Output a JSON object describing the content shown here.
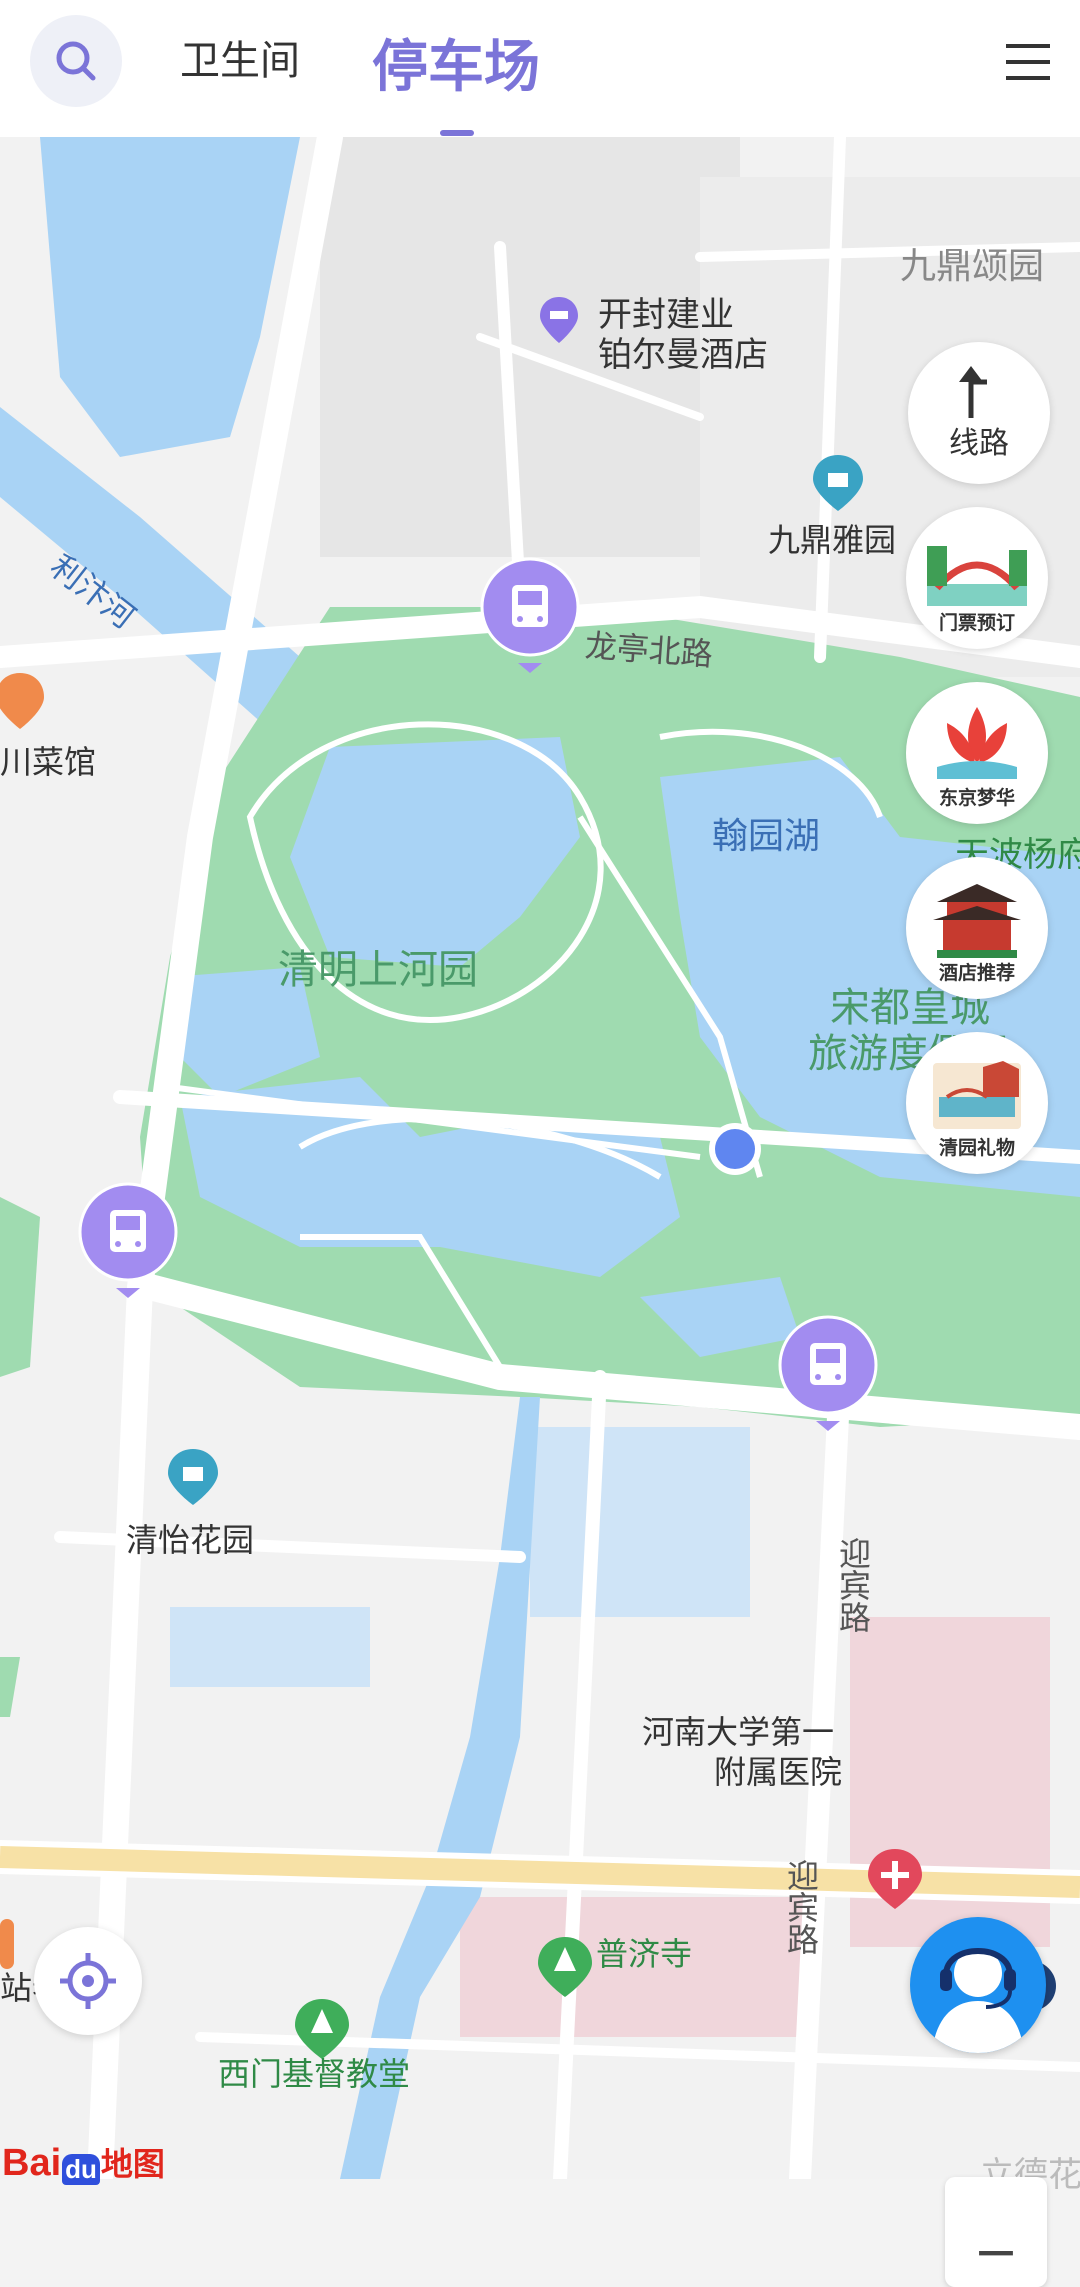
{
  "header": {
    "search_icon": "search-icon",
    "tabs": [
      {
        "label": "卫生间",
        "active": false
      },
      {
        "label": "停车场",
        "active": true
      }
    ],
    "menu_icon": "hamburger-menu-icon",
    "accent_color": "#7b74d8"
  },
  "map": {
    "labels": {
      "jiuding_song": "九鼎颂园",
      "hotel_line1": "开封建业",
      "hotel_line2": "铂尔曼酒店",
      "jiuding_ya": "九鼎雅园",
      "river": "利汴河",
      "longting_road": "龙亭北路",
      "sichuan": "川菜馆",
      "hanyuan_lake": "翰园湖",
      "tianbo": "天波杨府",
      "qingming": "清明上河园",
      "songdu_line1": "宋都皇城",
      "songdu_line2": "旅游度假区",
      "yingbin_road_1": "迎宾路",
      "qingyi": "清怡花园",
      "hospital_line1": "河南大学第一",
      "hospital_line2": "附属医院",
      "puji": "普济寺",
      "old_shop": "站老店",
      "yingbin_road_2": "迎宾路",
      "ximen_church": "西门基督教堂",
      "lide": "立德花",
      "baidu_logo_left": "Bai",
      "baidu_logo_du": "du",
      "baidu_logo_right": "地图"
    },
    "route_button": {
      "label": "线路",
      "icon": "turn-arrow-icon"
    },
    "promos": [
      {
        "label": "门票预订",
        "icon": "bridge-icon"
      },
      {
        "label": "东京梦华",
        "icon": "lotus-icon"
      },
      {
        "label": "酒店推荐",
        "icon": "pavilion-icon"
      },
      {
        "label": "清园礼物",
        "icon": "gift-icon"
      }
    ],
    "parking_pins": 4,
    "locate_icon": "locate-icon",
    "service_icon": "customer-service-icon",
    "zoom_out_symbol": "−"
  }
}
